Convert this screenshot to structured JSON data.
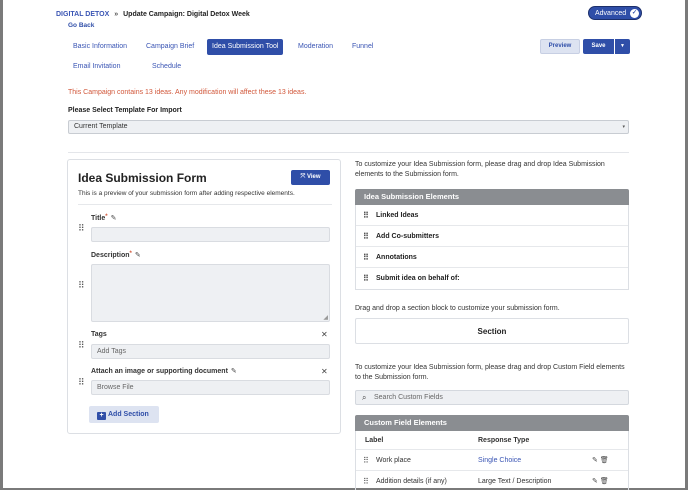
{
  "breadcrumb": {
    "brand": "DIGITAL DETOX",
    "separator": "»",
    "page": "Update Campaign: Digital Detox Week"
  },
  "mode_toggle": {
    "label": "Advanced",
    "check": "✓"
  },
  "go_back": "Go Back",
  "tabs": [
    {
      "label": "Basic Information"
    },
    {
      "label": "Campaign Brief"
    },
    {
      "label": "Idea Submission Tool"
    },
    {
      "label": "Moderation"
    },
    {
      "label": "Funnel"
    },
    {
      "label": "Email Invitation"
    },
    {
      "label": "Schedule"
    }
  ],
  "active_tab": "Idea Submission Tool",
  "actions": {
    "preview": "Preview",
    "save": "Save",
    "caret": "▼"
  },
  "notice": "This Campaign contains 13 ideas. Any modification will affect these 13 ideas.",
  "template": {
    "label": "Please Select Template For Import",
    "selected": "Current Template",
    "arrow": "▾"
  },
  "form_preview": {
    "title": "Idea Submission Form",
    "view_label": "View",
    "view_icon": "⤧",
    "subtitle": "This is a preview of your submission form after adding respective elements.",
    "fields": [
      {
        "label": "Title",
        "required": true
      },
      {
        "label": "Description",
        "required": true
      },
      {
        "label": "Tags",
        "placeholder": "Add Tags"
      },
      {
        "label": "Attach an image or supporting document",
        "placeholder": "Browse File"
      }
    ],
    "required_mark": "*",
    "pencil": "✎",
    "close": "✕",
    "grip": "⠿",
    "add_section": "Add Section",
    "add_section_icon": "+"
  },
  "right_panel": {
    "intro": "To customize your Idea Submission form, please drag and drop Idea Submission elements to the Submission form.",
    "elements_header": "Idea Submission Elements",
    "elements": [
      "Linked Ideas",
      "Add Co-submitters",
      "Annotations",
      "Submit idea on behalf of:"
    ],
    "section_hint": "Drag and drop a section block to customize your submission form.",
    "section_block": "Section",
    "custom_intro": "To customize your Idea Submission form, please drag and drop Custom Field elements to the Submission form.",
    "search_placeholder": "Search Custom Fields",
    "search_icon": "⌕",
    "custom_header": "Custom Field Elements",
    "columns": {
      "label": "Label",
      "type": "Response Type"
    },
    "custom_fields": [
      {
        "label": "Work place",
        "type": "Single Choice",
        "is_link": true
      },
      {
        "label": "Addition details (if any)",
        "type": "Large Text / Description",
        "is_link": false
      }
    ],
    "edit_icon": "✎",
    "delete_icon": "🗑"
  },
  "colors": {
    "primary": "#2f4ea8",
    "link": "#3a55b4",
    "notice": "#d1573a",
    "panel_header": "#8a8d91"
  }
}
